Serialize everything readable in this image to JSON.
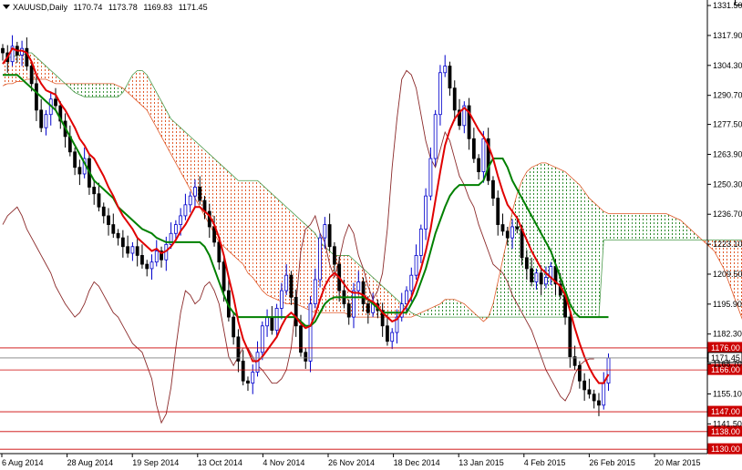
{
  "header": {
    "symbol": "XAUUSD,Daily",
    "open": "1170.74",
    "high": "1173.78",
    "low": "1169.83",
    "close": "1171.45"
  },
  "chart_data": {
    "type": "candlestick",
    "ylim": [
      1128,
      1334
    ],
    "xlim": [
      0,
      146
    ],
    "y_ticks": [
      1331.5,
      1317.9,
      1304.3,
      1290.7,
      1277.5,
      1263.9,
      1250.3,
      1236.7,
      1223.1,
      1209.5,
      1195.9,
      1182.3,
      1168.7,
      1155.1,
      1141.5
    ],
    "x_tick_labels": [
      {
        "i": 0,
        "label": "6 Aug 2014"
      },
      {
        "i": 16,
        "label": "28 Aug 2014"
      },
      {
        "i": 34,
        "label": "19 Sep 2014"
      },
      {
        "i": 52,
        "label": "13 Oct 2014"
      },
      {
        "i": 70,
        "label": "4 Nov 2014"
      },
      {
        "i": 86,
        "label": "26 Nov 2014"
      },
      {
        "i": 104,
        "label": "18 Dec 2014"
      },
      {
        "i": 122,
        "label": "13 Jan 2015"
      },
      {
        "i": 138,
        "label": "4 Feb 2015"
      },
      {
        "i": 156,
        "label": "26 Feb 2015"
      },
      {
        "i": 172,
        "label": "20 Mar 2015"
      }
    ],
    "levels": [
      {
        "value": 1176.0,
        "label": "1176.00",
        "color": "#cc0000",
        "box": "#cc0000"
      },
      {
        "value": 1171.45,
        "label": "1171.45",
        "color": "#7f7f7f",
        "box": "#ffffff"
      },
      {
        "value": 1166.0,
        "label": "1166.00",
        "color": "#cc0000",
        "box": "#cc0000"
      },
      {
        "value": 1147.0,
        "label": "1147.00",
        "color": "#cc0000",
        "box": "#cc0000"
      },
      {
        "value": 1138.0,
        "label": "1138.00",
        "color": "#cc0000",
        "box": "#cc0000"
      },
      {
        "value": 1130.0,
        "label": "1130.00",
        "color": "#cc0000",
        "box": "#cc0000"
      }
    ],
    "closes": [
      1310,
      1306,
      1313,
      1309,
      1312,
      1304,
      1296,
      1284,
      1276,
      1282,
      1289,
      1286,
      1279,
      1272,
      1265,
      1258,
      1255,
      1262,
      1249,
      1246,
      1240,
      1236,
      1232,
      1228,
      1226,
      1222,
      1219,
      1222,
      1218,
      1214,
      1212,
      1215,
      1220,
      1216,
      1223,
      1228,
      1232,
      1236,
      1241,
      1245,
      1249,
      1243,
      1238,
      1231,
      1224,
      1215,
      1202,
      1190,
      1181,
      1170,
      1161,
      1160,
      1165,
      1174,
      1186,
      1190,
      1184,
      1194,
      1202,
      1209,
      1199,
      1186,
      1174,
      1170,
      1196,
      1207,
      1226,
      1232,
      1222,
      1214,
      1202,
      1196,
      1190,
      1202,
      1206,
      1196,
      1192,
      1196,
      1193,
      1186,
      1179,
      1183,
      1190,
      1196,
      1202,
      1209,
      1218,
      1230,
      1245,
      1262,
      1282,
      1301,
      1304,
      1294,
      1284,
      1277,
      1286,
      1271,
      1262,
      1256,
      1271,
      1252,
      1244,
      1232,
      1229,
      1226,
      1231,
      1230,
      1217,
      1212,
      1206,
      1210,
      1205,
      1208,
      1213,
      1205,
      1200,
      1190,
      1172,
      1168,
      1161,
      1157,
      1155,
      1152,
      1150,
      1160,
      1171.45
    ],
    "tenkan": [
      1305,
      1308,
      1312,
      1311,
      1311,
      1310,
      1306,
      1300,
      1296,
      1293,
      1292,
      1291,
      1287,
      1284,
      1280,
      1276,
      1271,
      1268,
      1264,
      1262,
      1258,
      1254,
      1249,
      1245,
      1240,
      1236,
      1233,
      1230,
      1226,
      1224,
      1222,
      1220,
      1221,
      1219,
      1220,
      1222,
      1225,
      1229,
      1232,
      1236,
      1240,
      1240,
      1238,
      1236,
      1232,
      1226,
      1218,
      1208,
      1199,
      1188,
      1180,
      1175,
      1170,
      1170,
      1172,
      1175,
      1178,
      1181,
      1186,
      1190,
      1192,
      1190,
      1187,
      1185,
      1186,
      1191,
      1198,
      1204,
      1208,
      1210,
      1208,
      1205,
      1202,
      1201,
      1201,
      1200,
      1198,
      1197,
      1195,
      1192,
      1190,
      1188,
      1189,
      1192,
      1195,
      1199,
      1205,
      1212,
      1220,
      1230,
      1243,
      1256,
      1268,
      1275,
      1280,
      1283,
      1285,
      1283,
      1279,
      1275,
      1272,
      1268,
      1262,
      1254,
      1247,
      1241,
      1238,
      1235,
      1230,
      1225,
      1220,
      1216,
      1212,
      1210,
      1208,
      1206,
      1204,
      1200,
      1193,
      1185,
      1178,
      1172,
      1167,
      1163,
      1160,
      1160,
      1164
    ],
    "kijun": [
      1300,
      1300,
      1300,
      1300,
      1298,
      1296,
      1294,
      1292,
      1290,
      1288,
      1286,
      1284,
      1280,
      1276,
      1272,
      1268,
      1264,
      1260,
      1256,
      1252,
      1250,
      1248,
      1246,
      1244,
      1240,
      1238,
      1236,
      1234,
      1232,
      1230,
      1229,
      1228,
      1226,
      1225,
      1224,
      1224,
      1224,
      1224,
      1224,
      1224,
      1224,
      1224,
      1222,
      1218,
      1212,
      1206,
      1200,
      1195,
      1192,
      1190,
      1190,
      1190,
      1190,
      1190,
      1190,
      1190,
      1190,
      1190,
      1190,
      1190,
      1190,
      1190,
      1188,
      1186,
      1186,
      1188,
      1192,
      1196,
      1198,
      1199,
      1199,
      1199,
      1199,
      1199,
      1199,
      1199,
      1198,
      1196,
      1194,
      1192,
      1192,
      1192,
      1192,
      1192,
      1192,
      1196,
      1200,
      1206,
      1212,
      1220,
      1228,
      1234,
      1240,
      1245,
      1248,
      1250,
      1250,
      1250,
      1250,
      1250,
      1252,
      1258,
      1262,
      1262,
      1262,
      1258,
      1252,
      1248,
      1244,
      1240,
      1236,
      1232,
      1228,
      1224,
      1220,
      1214,
      1208,
      1202,
      1196,
      1192,
      1190,
      1190,
      1190,
      1190,
      1190,
      1190,
      1190
    ],
    "span_a": [
      1295,
      1296,
      1296,
      1297,
      1297,
      1298,
      1298,
      1298,
      1298,
      1298,
      1297,
      1296,
      1296,
      1296,
      1296,
      1296,
      1296,
      1296,
      1296,
      1296,
      1296,
      1296,
      1296,
      1296,
      1295,
      1294,
      1292,
      1290,
      1288,
      1286,
      1284,
      1280,
      1276,
      1272,
      1268,
      1264,
      1260,
      1256,
      1252,
      1248,
      1244,
      1240,
      1236,
      1232,
      1228,
      1224,
      1222,
      1220,
      1218,
      1216,
      1214,
      1210,
      1208,
      1205,
      1202,
      1200,
      1199,
      1198,
      1197,
      1196,
      1196,
      1196,
      1195,
      1194,
      1193,
      1192,
      1192,
      1192,
      1192,
      1192,
      1192,
      1192,
      1191,
      1190,
      1190,
      1190,
      1190,
      1190,
      1190,
      1190,
      1190,
      1190,
      1190,
      1190,
      1190,
      1190,
      1191,
      1192,
      1193,
      1194,
      1195,
      1196,
      1198,
      1198,
      1198,
      1197,
      1196,
      1194,
      1192,
      1190,
      1188,
      1190,
      1196,
      1206,
      1216,
      1226,
      1238,
      1246,
      1252,
      1256,
      1258,
      1259,
      1260,
      1260,
      1259,
      1258,
      1257,
      1256,
      1254,
      1252,
      1250,
      1247,
      1244,
      1242,
      1240,
      1238,
      1237,
      1237,
      1237,
      1237,
      1237,
      1237,
      1237,
      1237,
      1237,
      1237,
      1237,
      1237,
      1237,
      1236,
      1235,
      1234,
      1232,
      1230,
      1228,
      1226,
      1224,
      1222,
      1220,
      1216,
      1212,
      1206,
      1200,
      1194,
      1188,
      1182,
      1177,
      1176
    ],
    "span_b": [
      1305,
      1308,
      1308,
      1309,
      1309,
      1310,
      1310,
      1308,
      1306,
      1304,
      1302,
      1300,
      1298,
      1296,
      1294,
      1292,
      1291,
      1290,
      1290,
      1290,
      1290,
      1290,
      1290,
      1290,
      1290,
      1292,
      1296,
      1300,
      1302,
      1302,
      1300,
      1296,
      1292,
      1288,
      1284,
      1280,
      1278,
      1276,
      1274,
      1272,
      1270,
      1268,
      1266,
      1264,
      1262,
      1260,
      1258,
      1256,
      1254,
      1252,
      1252,
      1252,
      1252,
      1252,
      1250,
      1248,
      1246,
      1244,
      1242,
      1240,
      1238,
      1236,
      1234,
      1232,
      1230,
      1228,
      1224,
      1222,
      1220,
      1218,
      1218,
      1218,
      1218,
      1216,
      1214,
      1212,
      1210,
      1208,
      1206,
      1204,
      1202,
      1200,
      1198,
      1196,
      1194,
      1192,
      1191,
      1190,
      1190,
      1190,
      1190,
      1190,
      1190,
      1190,
      1190,
      1190,
      1190,
      1190,
      1190,
      1190,
      1190,
      1190,
      1190,
      1190,
      1190,
      1190,
      1190,
      1190,
      1190,
      1190,
      1190,
      1190,
      1190,
      1190,
      1190,
      1190,
      1190,
      1190,
      1190,
      1190,
      1190,
      1190,
      1190,
      1190,
      1190,
      1225,
      1225,
      1225,
      1225,
      1225,
      1225,
      1225,
      1225,
      1225,
      1225,
      1225,
      1225,
      1225,
      1225,
      1225,
      1225,
      1225,
      1225,
      1225,
      1225,
      1225,
      1225,
      1225,
      1225,
      1225,
      1225,
      1225,
      1225,
      1225,
      1225
    ],
    "chikou": [
      1232,
      1236,
      1238,
      1240,
      1236,
      1230,
      1226,
      1222,
      1218,
      1214,
      1210,
      1204,
      1200,
      1196,
      1193,
      1190,
      1192,
      1196,
      1202,
      1206,
      1204,
      1200,
      1196,
      1192,
      1190,
      1186,
      1182,
      1178,
      1176,
      1174,
      1168,
      1162,
      1150,
      1142,
      1146,
      1158,
      1176,
      1192,
      1202,
      1200,
      1196,
      1198,
      1204,
      1206,
      1202,
      1196,
      1184,
      1172,
      1168,
      1172,
      1176,
      1176,
      1172,
      1168,
      1166,
      1163,
      1160,
      1160,
      1162,
      1166,
      1176,
      1196,
      1220,
      1230,
      1232,
      1236,
      1228,
      1224,
      1214,
      1208,
      1216,
      1226,
      1232,
      1228,
      1218,
      1212,
      1204,
      1198,
      1202,
      1210,
      1230,
      1258,
      1280,
      1298,
      1302,
      1300,
      1294,
      1282,
      1270,
      1262,
      1258,
      1266,
      1274,
      1270,
      1262,
      1254,
      1250,
      1244,
      1240,
      1232,
      1226,
      1220,
      1214,
      1212,
      1210,
      1206,
      1200,
      1196,
      1192,
      1188,
      1184,
      1178,
      1172,
      1166,
      1162,
      1158,
      1154,
      1152,
      1156,
      1164,
      1168,
      1170,
      1171,
      1171
    ]
  }
}
